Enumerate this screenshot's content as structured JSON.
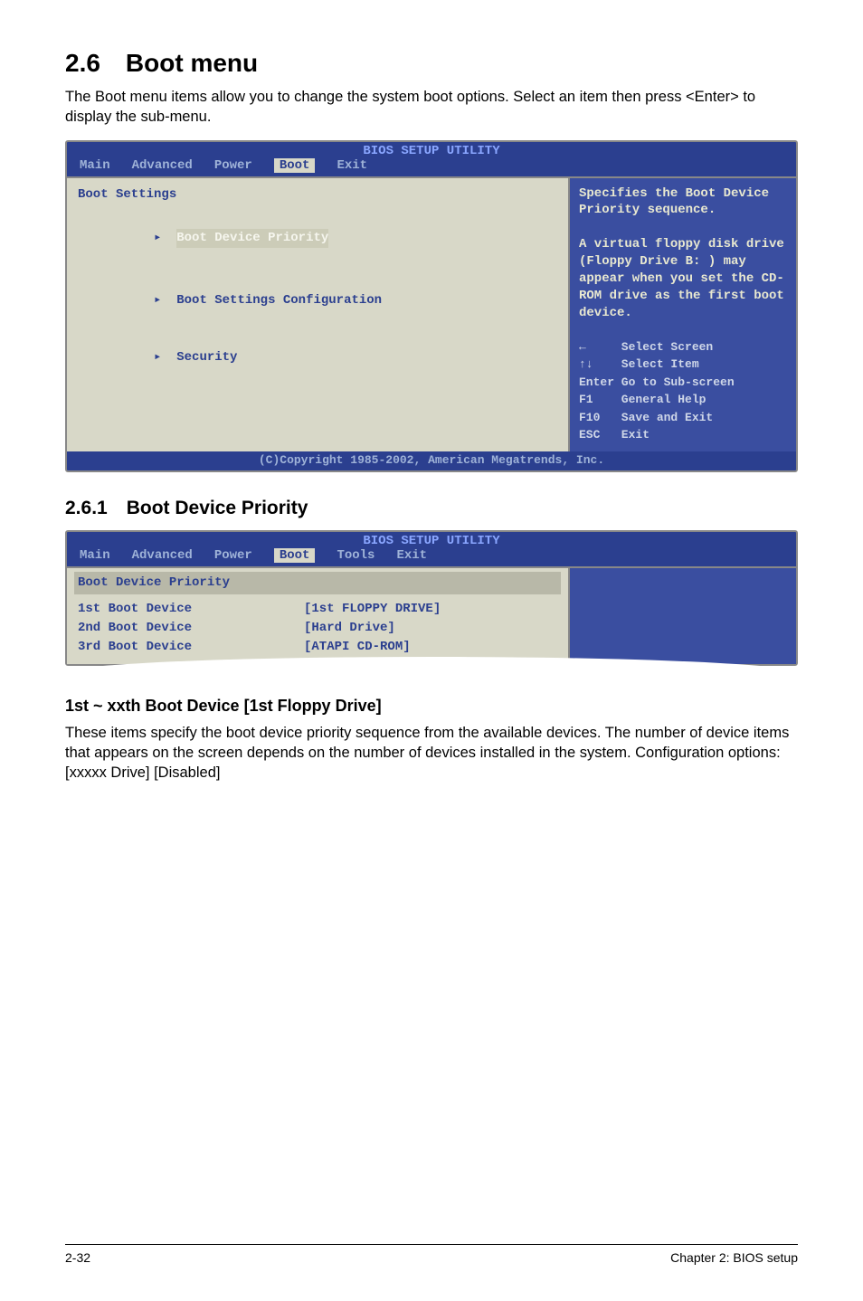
{
  "heading": "2.6 Boot menu",
  "intro": "The Boot menu items allow you to change the system boot options. Select an item then press <Enter> to display the sub-menu.",
  "bios1": {
    "headerTitle": "BIOS SETUP UTILITY",
    "tabs": {
      "main": "Main",
      "advanced": "Advanced",
      "power": "Power",
      "boot": "Boot",
      "exit": "Exit"
    },
    "left": {
      "title": "Boot Settings",
      "item1": "Boot Device Priority",
      "item2": "Boot Settings Configuration",
      "item3": "Security"
    },
    "right": {
      "desc": "Specifies the Boot Device Priority sequence.\n\nA virtual floppy disk drive (Floppy Drive B: ) may appear when you set the CD-ROM drive as the first boot device.",
      "help": "←     Select Screen\n↑↓    Select Item\nEnter Go to Sub-screen\nF1    General Help\nF10   Save and Exit\nESC   Exit"
    },
    "footer": "(C)Copyright 1985-2002, American Megatrends, Inc."
  },
  "subheading": "2.6.1 Boot Device Priority",
  "bios2": {
    "headerTitle": "BIOS SETUP UTILITY",
    "tabs": {
      "main": "Main",
      "advanced": "Advanced",
      "power": "Power",
      "boot": "Boot",
      "tools": "Tools",
      "exit": "Exit"
    },
    "title": "Boot Device Priority",
    "rows": [
      {
        "k": "1st Boot Device",
        "v": "[1st FLOPPY DRIVE]"
      },
      {
        "k": "2nd Boot Device",
        "v": "[Hard Drive]"
      },
      {
        "k": "3rd Boot Device",
        "v": "[ATAPI CD-ROM]"
      }
    ]
  },
  "h3": "1st ~ xxth Boot Device [1st Floppy Drive]",
  "body": "These items specify the boot device priority sequence from the available devices. The number of device items that appears on the screen depends on the number of devices installed in the system. Configuration options: [xxxxx Drive] [Disabled]",
  "footer": {
    "left": "2-32",
    "right": "Chapter 2: BIOS setup"
  }
}
